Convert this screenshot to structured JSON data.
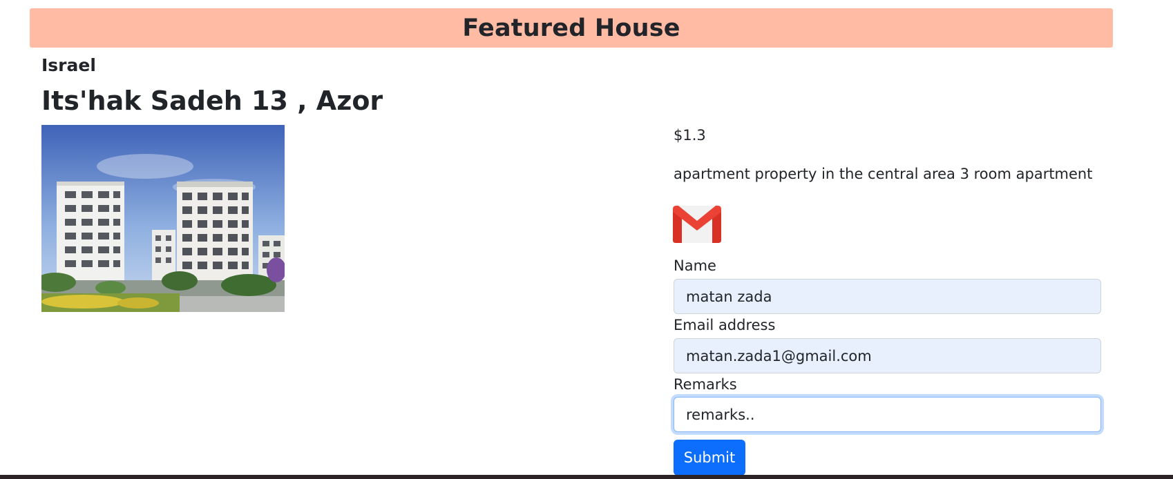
{
  "banner": {
    "title": "Featured House"
  },
  "listing": {
    "country": "Israel",
    "address": "Its'hak Sadeh 13 , Azor",
    "price": "$1.3",
    "description": "apartment property in the central area 3 room apartment"
  },
  "form": {
    "name_label": "Name",
    "name_value": "matan zada",
    "email_label": "Email address",
    "email_value": "matan.zada1@gmail.com",
    "remarks_label": "Remarks",
    "remarks_value": "remarks..",
    "submit_label": "Submit"
  },
  "icons": {
    "mail": "gmail-icon",
    "photo": "house-photo"
  },
  "colors": {
    "banner_bg": "#ffbba4",
    "submit_bg": "#0d6efd",
    "autofill_bg": "#e8f0fe",
    "gmail_red": "#ea4335"
  }
}
